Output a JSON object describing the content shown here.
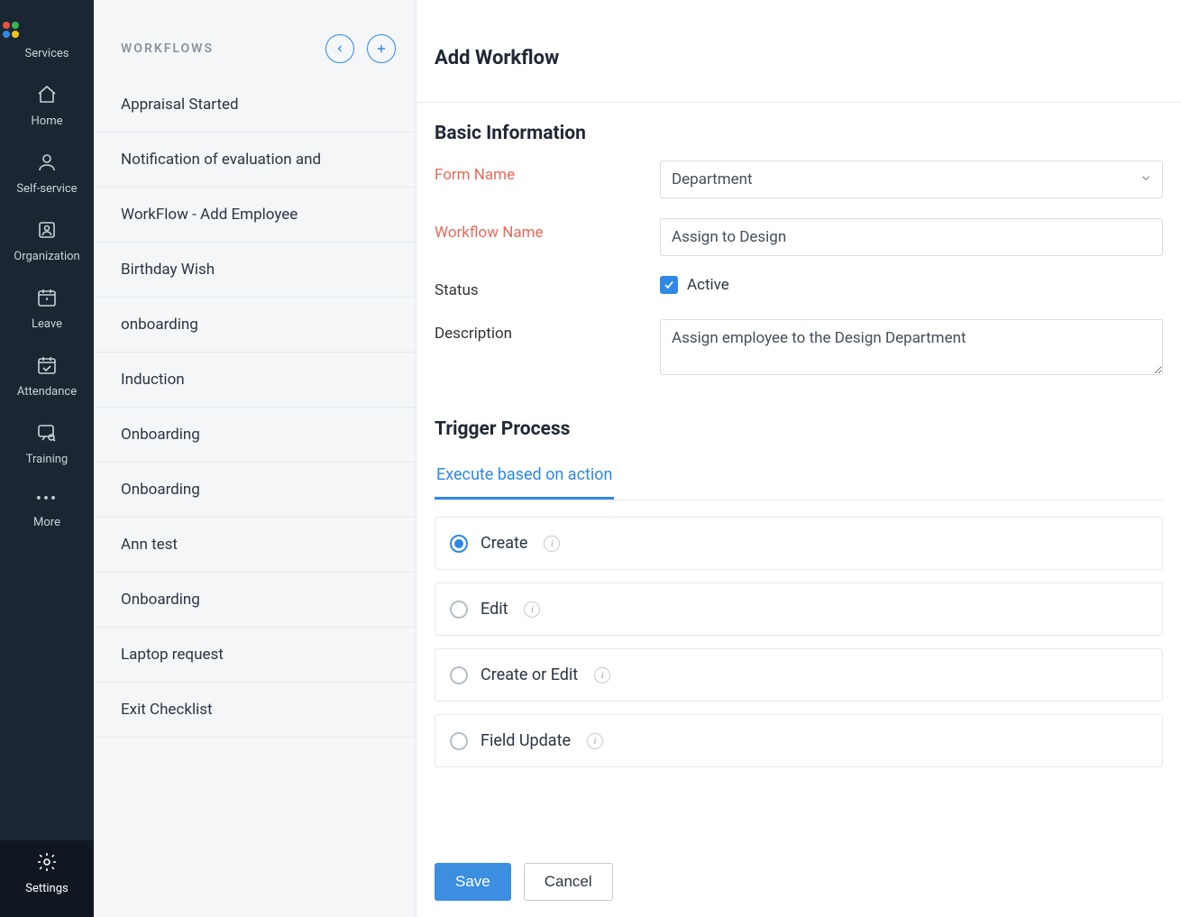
{
  "nav": {
    "items": [
      {
        "label": "Services"
      },
      {
        "label": "Home"
      },
      {
        "label": "Self-service"
      },
      {
        "label": "Organization"
      },
      {
        "label": "Leave"
      },
      {
        "label": "Attendance"
      },
      {
        "label": "Training"
      },
      {
        "label": "More"
      },
      {
        "label": "Settings"
      }
    ]
  },
  "workflow_list": {
    "heading": "WORKFLOWS",
    "items": [
      "Appraisal Started",
      "Notification of evaluation and",
      "WorkFlow - Add Employee",
      "Birthday Wish",
      "onboarding",
      "Induction",
      "Onboarding",
      "Onboarding",
      "Ann test",
      "Onboarding",
      "Laptop request",
      "Exit Checklist"
    ]
  },
  "main": {
    "title": "Add Workflow",
    "basic_info_heading": "Basic Information",
    "form_name_label": "Form Name",
    "form_name_value": "Department",
    "workflow_name_label": "Workflow Name",
    "workflow_name_value": "Assign to Design",
    "status_label": "Status",
    "status_checkbox_label": "Active",
    "status_checked": true,
    "description_label": "Description",
    "description_value": "Assign employee to the Design Department",
    "trigger_heading": "Trigger Process",
    "trigger_tab": "Execute based on action",
    "trigger_options": [
      {
        "label": "Create",
        "selected": true
      },
      {
        "label": "Edit",
        "selected": false
      },
      {
        "label": "Create or Edit",
        "selected": false
      },
      {
        "label": "Field Update",
        "selected": false
      }
    ],
    "save_label": "Save",
    "cancel_label": "Cancel"
  }
}
